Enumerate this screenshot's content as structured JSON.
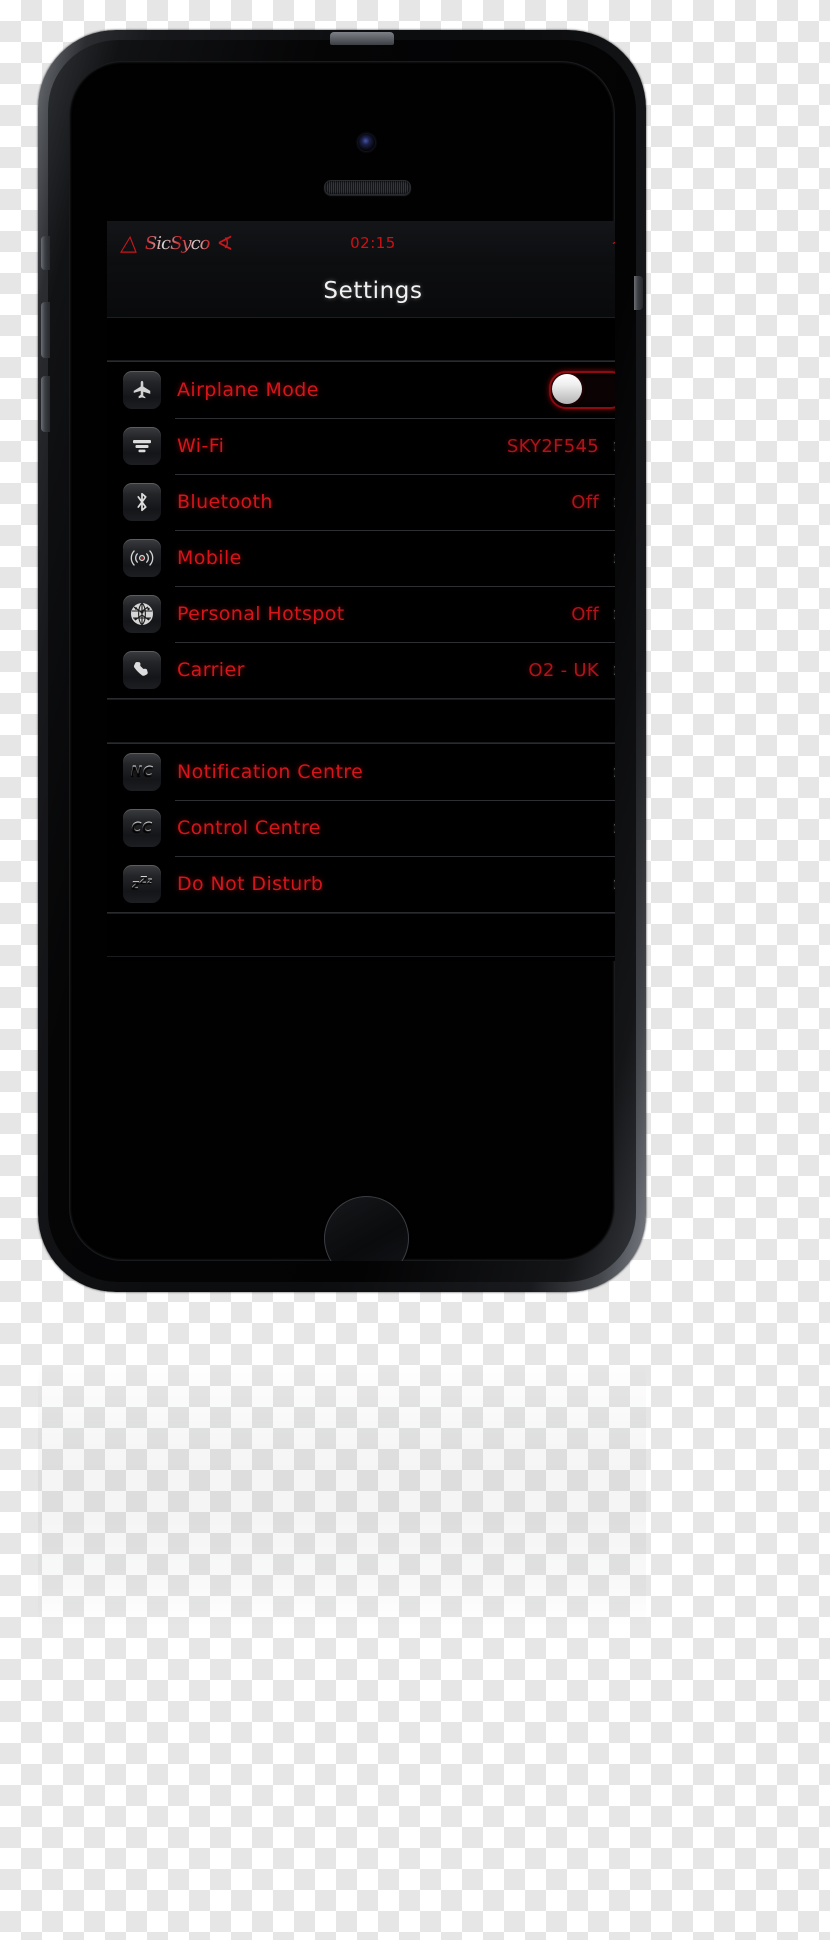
{
  "status_bar": {
    "signal_icon": "signal-bars-icon",
    "carrier_name": "SicSyco",
    "wifi_icon": "wifi-icon",
    "time": "02:15",
    "battery_icon": "battery-icon"
  },
  "nav_bar": {
    "title": "Settings"
  },
  "theme": {
    "accent_red": "#d6151b",
    "value_red": "#b0131a",
    "status_red": "#c8171c",
    "chevron_gray": "#cccccc",
    "screen_bg": "#000000"
  },
  "groups": [
    {
      "rows": [
        {
          "icon": "airplane-icon",
          "icon_glyph": "✈",
          "label": "Airplane Mode",
          "control": "toggle",
          "toggle_on": false,
          "value": "",
          "chevron": ""
        },
        {
          "icon": "wifi-bars-icon",
          "icon_glyph": "wifi-stack",
          "label": "Wi-Fi",
          "control": "disclosure",
          "value": "SKY2F545",
          "chevron": "»"
        },
        {
          "icon": "bluetooth-icon",
          "icon_glyph": "ᛒ",
          "label": "Bluetooth",
          "control": "disclosure",
          "value": "Off",
          "chevron": "»"
        },
        {
          "icon": "cellular-radio-icon",
          "icon_glyph": "cellular",
          "label": "Mobile",
          "control": "disclosure",
          "value": "",
          "chevron": "»"
        },
        {
          "icon": "personal-hotspot-icon",
          "icon_glyph": "hotspot",
          "label": "Personal Hotspot",
          "control": "disclosure",
          "value": "Off",
          "chevron": "»"
        },
        {
          "icon": "phone-handset-icon",
          "icon_glyph": "☎",
          "label": "Carrier",
          "control": "disclosure",
          "value": "O2 - UK",
          "chevron": "»"
        }
      ]
    },
    {
      "rows": [
        {
          "icon": "notification-centre-icon",
          "icon_glyph": "NC",
          "label": "Notification Centre",
          "control": "disclosure",
          "value": "",
          "chevron": "»"
        },
        {
          "icon": "control-centre-icon",
          "icon_glyph": "CC",
          "label": "Control Centre",
          "control": "disclosure",
          "value": "",
          "chevron": "»"
        },
        {
          "icon": "do-not-disturb-icon",
          "icon_glyph": "zᶻz",
          "label": "Do Not Disturb",
          "control": "disclosure",
          "value": "",
          "chevron": "»"
        }
      ]
    }
  ]
}
